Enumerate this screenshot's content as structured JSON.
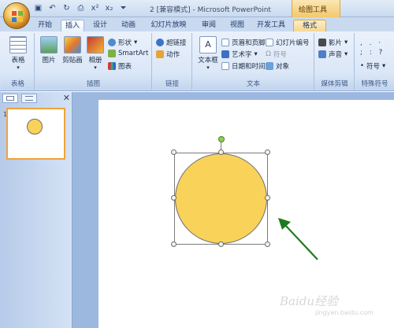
{
  "window": {
    "title": "2 [兼容模式] - Microsoft PowerPoint",
    "contextual_group": "绘图工具"
  },
  "qat": {
    "icons": [
      "save-icon",
      "undo-icon",
      "redo-icon",
      "print-icon",
      "superscript-icon",
      "subscript-icon",
      "customize-icon"
    ],
    "glyphs": [
      "▣",
      "↶",
      "↻",
      "⎙",
      "x²",
      "x₂",
      "⏷"
    ]
  },
  "tabs": [
    "开始",
    "插入",
    "设计",
    "动画",
    "幻灯片放映",
    "审阅",
    "视图",
    "开发工具",
    "格式"
  ],
  "active_tab": "插入",
  "ribbon": {
    "groups": {
      "tables": {
        "label": "表格",
        "table_btn": "表格"
      },
      "illustrations": {
        "label": "插图",
        "picture": "图片",
        "clipart": "剪贴画",
        "album": "相册",
        "shapes": "形状",
        "smartart": "SmartArt",
        "chart": "图表"
      },
      "links": {
        "label": "链接",
        "hyperlink": "超链接",
        "action": "动作"
      },
      "text": {
        "label": "文本",
        "textbox": "文本框",
        "header_footer": "页眉和页脚",
        "wordart": "艺术字",
        "datetime": "日期和时间",
        "slide_number": "幻灯片编号",
        "symbol": "符号",
        "object": "对象"
      },
      "media": {
        "label": "媒体剪辑",
        "movie": "影片",
        "sound": "声音"
      },
      "special_symbols": {
        "label": "特殊符号",
        "symbol": "符号"
      }
    }
  },
  "colors": {
    "shape_fill": "#f9d25a",
    "arrow": "#1f7a1f",
    "selection": "#f0a33a"
  },
  "slides_pane": {
    "slide_number": "1"
  },
  "watermark": {
    "brand": "Baidu经验",
    "url": "jingyan.baidu.com"
  }
}
